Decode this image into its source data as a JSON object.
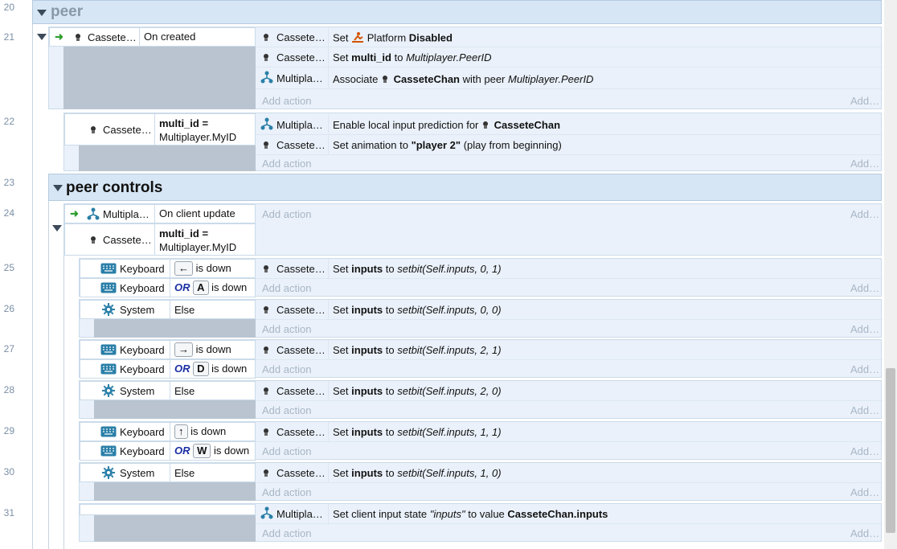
{
  "line_numbers": [
    "20",
    "21",
    "22",
    "23",
    "24",
    "25",
    "26",
    "27",
    "28",
    "29",
    "30",
    "31"
  ],
  "groups": {
    "peer": "peer",
    "peer_controls": "peer controls"
  },
  "objects": {
    "cassete": "Cassete…",
    "multipla": "Multipla…",
    "keyboard": "Keyboard",
    "system": "System"
  },
  "add_action": "Add action",
  "add_right": "Add…",
  "conds": {
    "on_created": "On created",
    "multi_id_line1": "multi_id =",
    "multi_id_line2": "Multiplayer.MyID",
    "on_client_update": "On client update",
    "is_down": "is down",
    "or": "OR",
    "else": "Else",
    "key_left": "←",
    "key_a": "A",
    "key_right": "→",
    "key_d": "D",
    "key_up": "↑",
    "key_w": "W"
  },
  "actions": {
    "e21_1_set": "Set",
    "e21_1_platform": "Platform",
    "e21_1_disabled": "Disabled",
    "e21_2_set": "Set",
    "e21_2_var": "multi_id",
    "e21_2_to": "to",
    "e21_2_val": "Multiplayer.PeerID",
    "e21_3_assoc": "Associate",
    "e21_3_obj": "CasseteChan",
    "e21_3_with": "with peer",
    "e21_3_val": "Multiplayer.PeerID",
    "e22_1_text": "Enable local input prediction for",
    "e22_1_obj": "CasseteChan",
    "e22_2_text": "Set animation to",
    "e22_2_anim": "\"player 2\"",
    "e22_2_tail": "(play from beginning)",
    "set": "Set",
    "inputs": "inputs",
    "to": "to",
    "e25_val": "setbit(Self.inputs, 0, 1)",
    "e26_val": "setbit(Self.inputs, 0, 0)",
    "e27_val": "setbit(Self.inputs, 2, 1)",
    "e28_val": "setbit(Self.inputs, 2, 0)",
    "e29_val": "setbit(Self.inputs, 1, 1)",
    "e30_val": "setbit(Self.inputs, 1, 0)",
    "e31_text": "Set client input state",
    "e31_q": "\"inputs\"",
    "e31_to": "to value",
    "e31_val": "CasseteChan.inputs"
  },
  "colors": {
    "group_bg": "#d7e6f5",
    "event_bg": "#eaf1fa",
    "gray_block": "#b9c4d0",
    "or_blue": "#1a2ea3",
    "trigger_green": "#2e9e2e",
    "platform_orange": "#d35400",
    "multiplayer_teal": "#2a7fa8"
  }
}
